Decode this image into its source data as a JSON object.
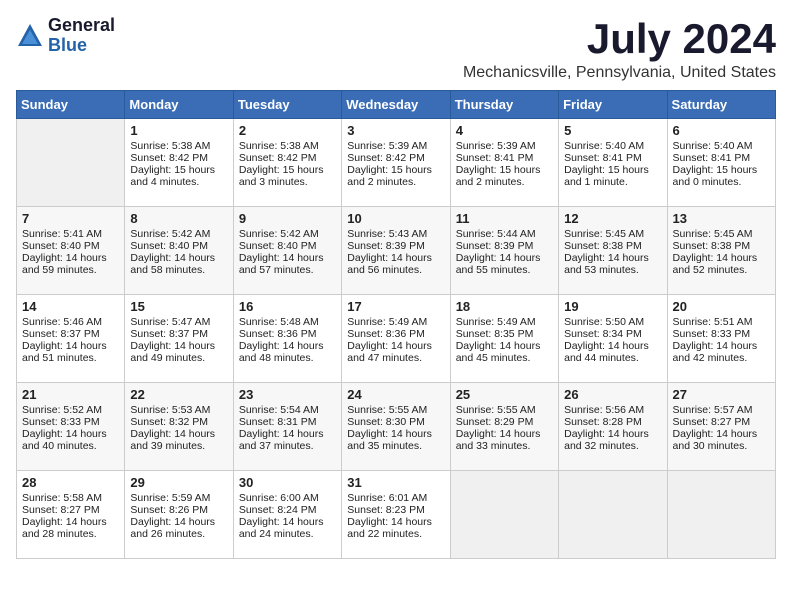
{
  "logo": {
    "general": "General",
    "blue": "Blue"
  },
  "title": "July 2024",
  "location": "Mechanicsville, Pennsylvania, United States",
  "days_header": [
    "Sunday",
    "Monday",
    "Tuesday",
    "Wednesday",
    "Thursday",
    "Friday",
    "Saturday"
  ],
  "weeks": [
    [
      {
        "day": "",
        "sunrise": "",
        "sunset": "",
        "daylight": ""
      },
      {
        "day": "1",
        "sunrise": "Sunrise: 5:38 AM",
        "sunset": "Sunset: 8:42 PM",
        "daylight": "Daylight: 15 hours and 4 minutes."
      },
      {
        "day": "2",
        "sunrise": "Sunrise: 5:38 AM",
        "sunset": "Sunset: 8:42 PM",
        "daylight": "Daylight: 15 hours and 3 minutes."
      },
      {
        "day": "3",
        "sunrise": "Sunrise: 5:39 AM",
        "sunset": "Sunset: 8:42 PM",
        "daylight": "Daylight: 15 hours and 2 minutes."
      },
      {
        "day": "4",
        "sunrise": "Sunrise: 5:39 AM",
        "sunset": "Sunset: 8:41 PM",
        "daylight": "Daylight: 15 hours and 2 minutes."
      },
      {
        "day": "5",
        "sunrise": "Sunrise: 5:40 AM",
        "sunset": "Sunset: 8:41 PM",
        "daylight": "Daylight: 15 hours and 1 minute."
      },
      {
        "day": "6",
        "sunrise": "Sunrise: 5:40 AM",
        "sunset": "Sunset: 8:41 PM",
        "daylight": "Daylight: 15 hours and 0 minutes."
      }
    ],
    [
      {
        "day": "7",
        "sunrise": "Sunrise: 5:41 AM",
        "sunset": "Sunset: 8:40 PM",
        "daylight": "Daylight: 14 hours and 59 minutes."
      },
      {
        "day": "8",
        "sunrise": "Sunrise: 5:42 AM",
        "sunset": "Sunset: 8:40 PM",
        "daylight": "Daylight: 14 hours and 58 minutes."
      },
      {
        "day": "9",
        "sunrise": "Sunrise: 5:42 AM",
        "sunset": "Sunset: 8:40 PM",
        "daylight": "Daylight: 14 hours and 57 minutes."
      },
      {
        "day": "10",
        "sunrise": "Sunrise: 5:43 AM",
        "sunset": "Sunset: 8:39 PM",
        "daylight": "Daylight: 14 hours and 56 minutes."
      },
      {
        "day": "11",
        "sunrise": "Sunrise: 5:44 AM",
        "sunset": "Sunset: 8:39 PM",
        "daylight": "Daylight: 14 hours and 55 minutes."
      },
      {
        "day": "12",
        "sunrise": "Sunrise: 5:45 AM",
        "sunset": "Sunset: 8:38 PM",
        "daylight": "Daylight: 14 hours and 53 minutes."
      },
      {
        "day": "13",
        "sunrise": "Sunrise: 5:45 AM",
        "sunset": "Sunset: 8:38 PM",
        "daylight": "Daylight: 14 hours and 52 minutes."
      }
    ],
    [
      {
        "day": "14",
        "sunrise": "Sunrise: 5:46 AM",
        "sunset": "Sunset: 8:37 PM",
        "daylight": "Daylight: 14 hours and 51 minutes."
      },
      {
        "day": "15",
        "sunrise": "Sunrise: 5:47 AM",
        "sunset": "Sunset: 8:37 PM",
        "daylight": "Daylight: 14 hours and 49 minutes."
      },
      {
        "day": "16",
        "sunrise": "Sunrise: 5:48 AM",
        "sunset": "Sunset: 8:36 PM",
        "daylight": "Daylight: 14 hours and 48 minutes."
      },
      {
        "day": "17",
        "sunrise": "Sunrise: 5:49 AM",
        "sunset": "Sunset: 8:36 PM",
        "daylight": "Daylight: 14 hours and 47 minutes."
      },
      {
        "day": "18",
        "sunrise": "Sunrise: 5:49 AM",
        "sunset": "Sunset: 8:35 PM",
        "daylight": "Daylight: 14 hours and 45 minutes."
      },
      {
        "day": "19",
        "sunrise": "Sunrise: 5:50 AM",
        "sunset": "Sunset: 8:34 PM",
        "daylight": "Daylight: 14 hours and 44 minutes."
      },
      {
        "day": "20",
        "sunrise": "Sunrise: 5:51 AM",
        "sunset": "Sunset: 8:33 PM",
        "daylight": "Daylight: 14 hours and 42 minutes."
      }
    ],
    [
      {
        "day": "21",
        "sunrise": "Sunrise: 5:52 AM",
        "sunset": "Sunset: 8:33 PM",
        "daylight": "Daylight: 14 hours and 40 minutes."
      },
      {
        "day": "22",
        "sunrise": "Sunrise: 5:53 AM",
        "sunset": "Sunset: 8:32 PM",
        "daylight": "Daylight: 14 hours and 39 minutes."
      },
      {
        "day": "23",
        "sunrise": "Sunrise: 5:54 AM",
        "sunset": "Sunset: 8:31 PM",
        "daylight": "Daylight: 14 hours and 37 minutes."
      },
      {
        "day": "24",
        "sunrise": "Sunrise: 5:55 AM",
        "sunset": "Sunset: 8:30 PM",
        "daylight": "Daylight: 14 hours and 35 minutes."
      },
      {
        "day": "25",
        "sunrise": "Sunrise: 5:55 AM",
        "sunset": "Sunset: 8:29 PM",
        "daylight": "Daylight: 14 hours and 33 minutes."
      },
      {
        "day": "26",
        "sunrise": "Sunrise: 5:56 AM",
        "sunset": "Sunset: 8:28 PM",
        "daylight": "Daylight: 14 hours and 32 minutes."
      },
      {
        "day": "27",
        "sunrise": "Sunrise: 5:57 AM",
        "sunset": "Sunset: 8:27 PM",
        "daylight": "Daylight: 14 hours and 30 minutes."
      }
    ],
    [
      {
        "day": "28",
        "sunrise": "Sunrise: 5:58 AM",
        "sunset": "Sunset: 8:27 PM",
        "daylight": "Daylight: 14 hours and 28 minutes."
      },
      {
        "day": "29",
        "sunrise": "Sunrise: 5:59 AM",
        "sunset": "Sunset: 8:26 PM",
        "daylight": "Daylight: 14 hours and 26 minutes."
      },
      {
        "day": "30",
        "sunrise": "Sunrise: 6:00 AM",
        "sunset": "Sunset: 8:24 PM",
        "daylight": "Daylight: 14 hours and 24 minutes."
      },
      {
        "day": "31",
        "sunrise": "Sunrise: 6:01 AM",
        "sunset": "Sunset: 8:23 PM",
        "daylight": "Daylight: 14 hours and 22 minutes."
      },
      {
        "day": "",
        "sunrise": "",
        "sunset": "",
        "daylight": ""
      },
      {
        "day": "",
        "sunrise": "",
        "sunset": "",
        "daylight": ""
      },
      {
        "day": "",
        "sunrise": "",
        "sunset": "",
        "daylight": ""
      }
    ]
  ]
}
